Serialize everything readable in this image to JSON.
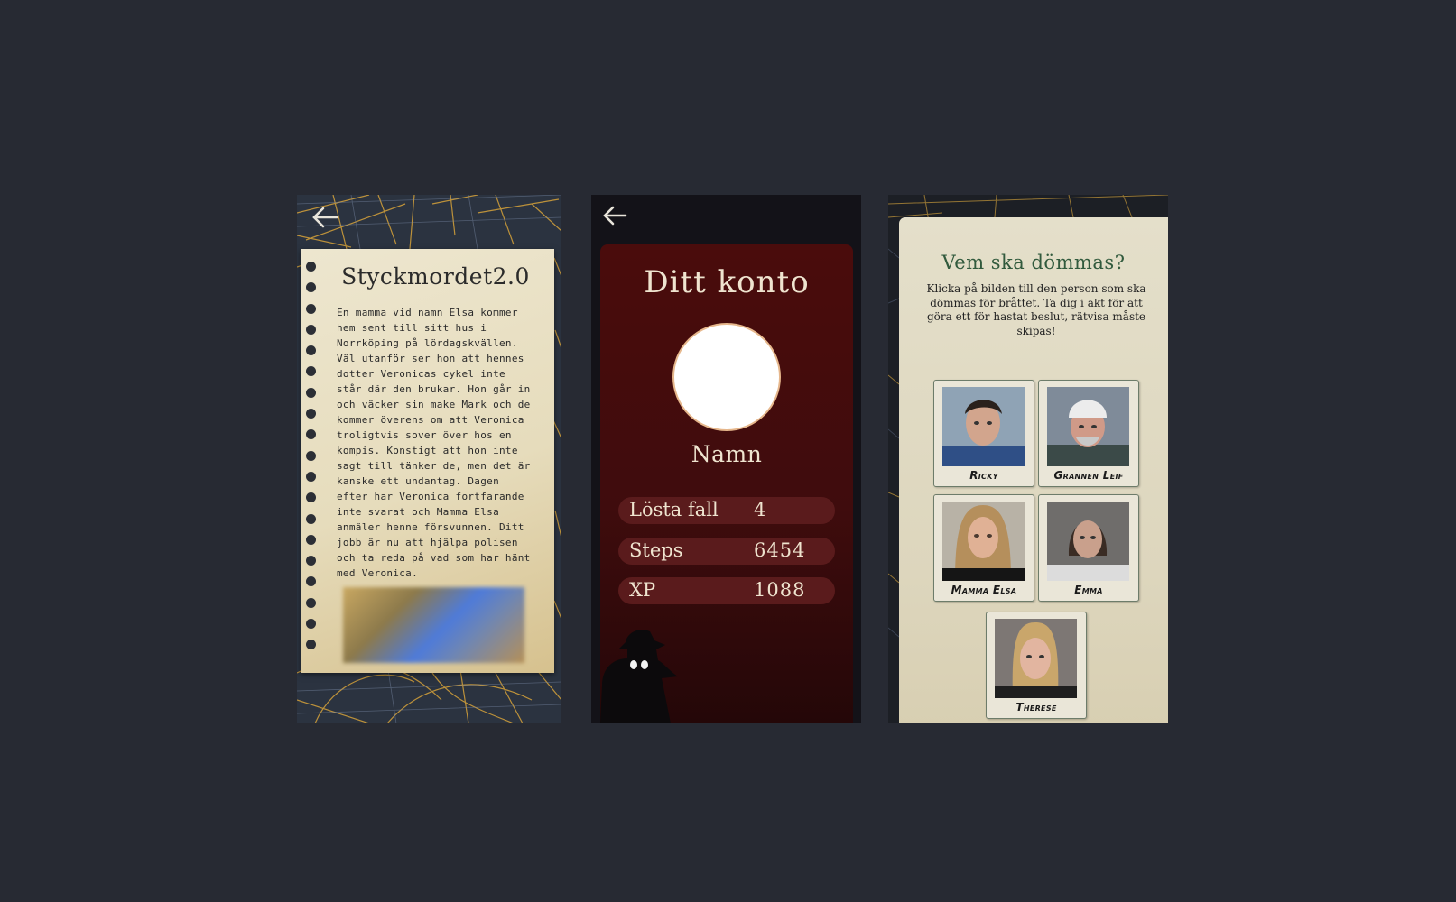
{
  "case_screen": {
    "title": "Styckmordet2.0",
    "story": "En mamma vid namn Elsa kommer hem sent till sitt hus i Norrköping på lördagskvällen. Väl utanför ser hon att hennes dotter Veronicas cykel inte står där den brukar. Hon går in och väcker sin make Mark och de kommer överens om att Veronica troligtvis sover över hos en kompis. Konstigt att hon inte sagt till tänker de, men det är kanske ett undantag.  Dagen efter har Veronica fortfarande inte svarat och Mamma Elsa anmäler henne försvunnen. Ditt jobb är nu att hjälpa polisen och ta reda på vad som har hänt med Veronica."
  },
  "account_screen": {
    "title": "Ditt konto",
    "name": "Namn",
    "stats": [
      {
        "label": "Lösta fall",
        "value": "4"
      },
      {
        "label": "Steps",
        "value": "6454"
      },
      {
        "label": "XP",
        "value": "1088"
      }
    ]
  },
  "verdict_screen": {
    "title": "Vem ska dömmas?",
    "instructions": "Klicka på bilden till den person som ska dömmas för bråttet. Ta dig i akt för att göra ett för hastat beslut, rätvisa måste skipas!",
    "suspects": [
      {
        "name": "Ricky"
      },
      {
        "name": "Grannen Leif"
      },
      {
        "name": "Mamma Elsa"
      },
      {
        "name": "Emma"
      },
      {
        "name": "Therese"
      }
    ]
  },
  "colors": {
    "page_bg": "#272a33",
    "map_line": "#d6a23a",
    "account_card": "#4a0c0c",
    "verdict_title": "#315a3d"
  },
  "icons": [
    "back-arrow-icon",
    "detective-silhouette-icon"
  ]
}
